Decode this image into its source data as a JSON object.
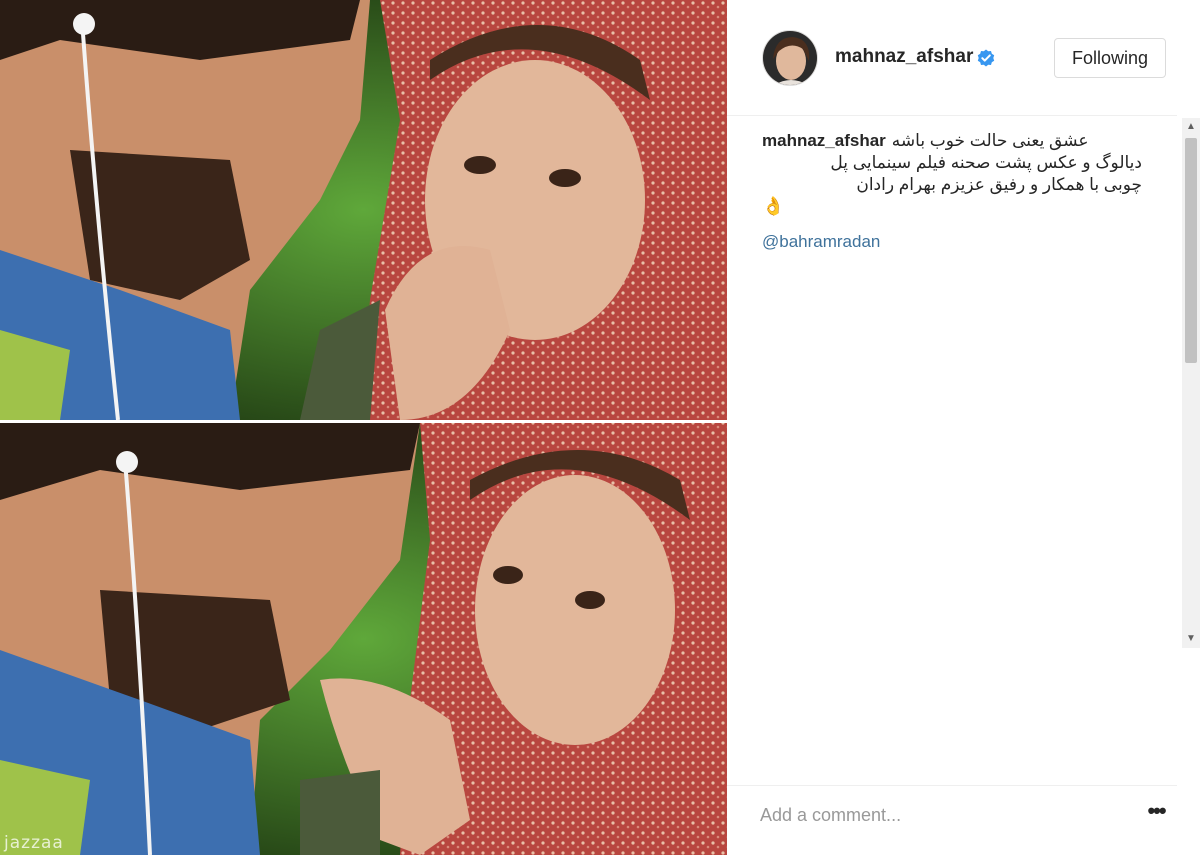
{
  "post": {
    "watermark": "jazzaa",
    "photo_description_alt": ""
  },
  "header": {
    "username": "mahnaz_afshar",
    "verified_icon": "verified-badge-icon",
    "follow_button_label": "Following"
  },
  "caption": {
    "username": "mahnaz_afshar",
    "line1": "عشق یعنی حالت خوب باشه",
    "line2": "دیالوگ و عکس پشت صحنه فیلم سینمایی پل",
    "line3": "چوبی با همکار و رفیق عزیزم بهرام رادان",
    "emoji": "👌",
    "mention": "@bahramradan"
  },
  "comment": {
    "placeholder": "Add a comment...",
    "more_label": "•••"
  },
  "colors": {
    "link": "#3f729b",
    "verified": "#3897f0",
    "text": "#262626"
  }
}
